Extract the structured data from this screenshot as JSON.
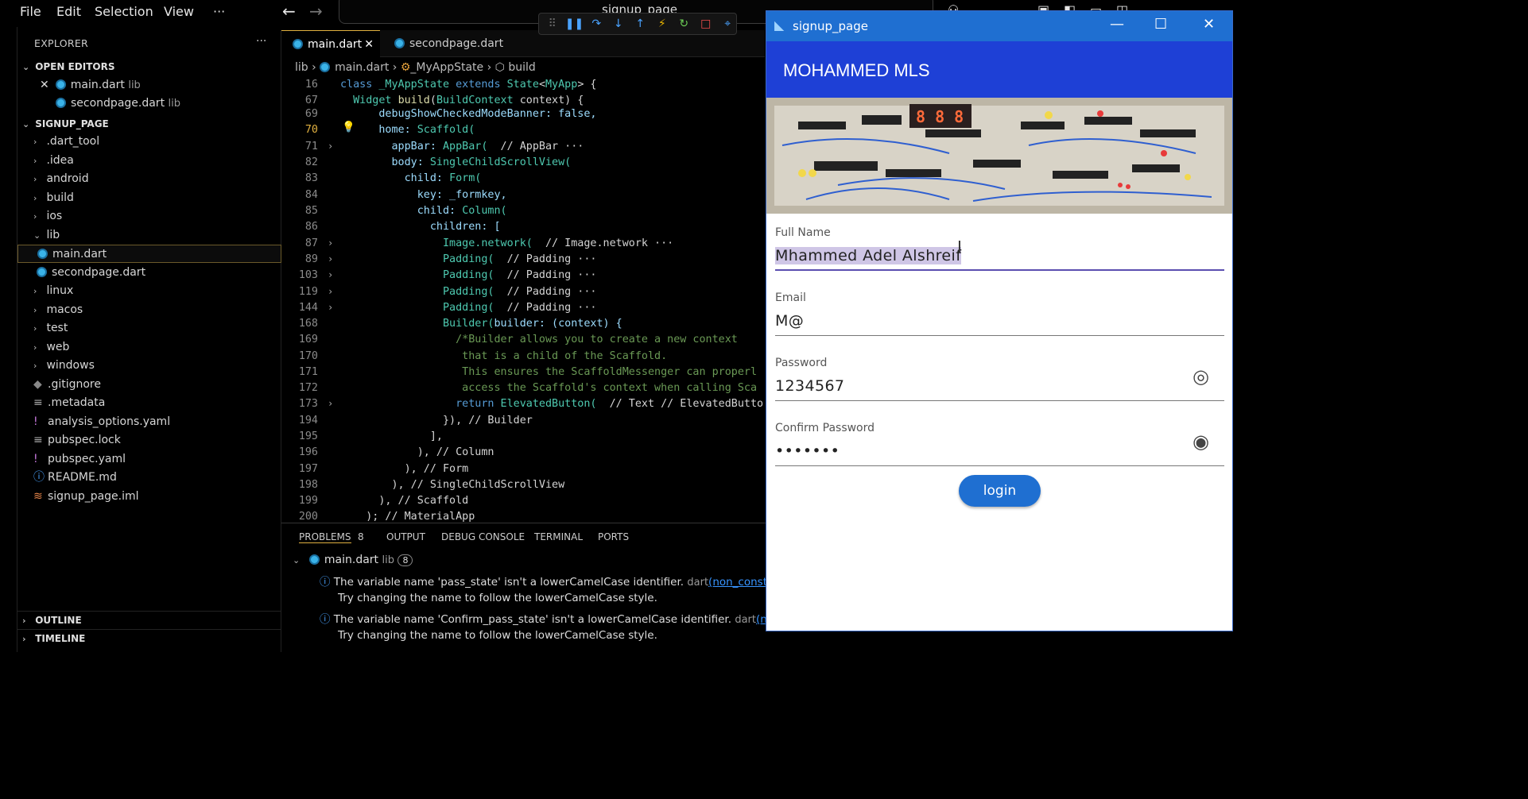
{
  "menubar": {
    "file": "File",
    "edit": "Edit",
    "selection": "Selection",
    "view": "View",
    "more": "···",
    "search": "signup_page"
  },
  "explorer": {
    "title": "EXPLORER",
    "open_editors": "OPEN EDITORS",
    "open": [
      {
        "name": "main.dart",
        "dir": "lib"
      },
      {
        "name": "secondpage.dart",
        "dir": "lib"
      }
    ],
    "project": "SIGNUP_PAGE",
    "items": [
      ".dart_tool",
      ".idea",
      "android",
      "build",
      "ios",
      "lib",
      "main.dart",
      "secondpage.dart",
      "linux",
      "macos",
      "test",
      "web",
      "windows",
      ".gitignore",
      ".metadata",
      "analysis_options.yaml",
      "pubspec.lock",
      "pubspec.yaml",
      "README.md",
      "signup_page.iml"
    ],
    "outline": "OUTLINE",
    "timeline": "TIMELINE"
  },
  "tabs": {
    "main": "main.dart",
    "second": "secondpage.dart"
  },
  "breadcrumb": {
    "lib": "lib",
    "file": "main.dart",
    "cls": "_MyAppState",
    "method": "build"
  },
  "code": {
    "lines": [
      "16",
      "67",
      "69",
      "70",
      "71",
      "82",
      "83",
      "84",
      "85",
      "86",
      "87",
      "89",
      "103",
      "119",
      "144",
      "168",
      "169",
      "170",
      "171",
      "172",
      "173",
      "194",
      "195",
      "196",
      "197",
      "198",
      "199",
      "200"
    ],
    "l16_a": "class ",
    "l16_b": "_MyAppState",
    "l16_c": " extends ",
    "l16_d": "State",
    "l16_e": "<",
    "l16_f": "MyApp",
    "l16_g": "> {",
    "l67_a": "  Widget ",
    "l67_b": "build",
    "l67_c": "(",
    "l67_d": "BuildContext",
    "l67_e": " context) {",
    "l69": "      debugShowCheckedModeBanner: false,",
    "l70_a": "      home: ",
    "l70_b": "Scaffold(",
    "l71_a": "        appBar: ",
    "l71_b": "AppBar(",
    "l71_c": "  // AppBar ···",
    "l82_a": "        body: ",
    "l82_b": "SingleChildScrollView(",
    "l83_a": "          child: ",
    "l83_b": "Form(",
    "l84": "            key: _formkey,",
    "l85_a": "            child: ",
    "l85_b": "Column(",
    "l86": "              children: [",
    "l87_a": "                ",
    "l87_b": "Image.network(",
    "l87_c": "  // Image.network ···",
    "l89_a": "                ",
    "l89_b": "Padding(",
    "l89_c": "  // Padding ···",
    "l103_c": "  // Padding ···",
    "l119_c": "  // Padding ···",
    "l144_c": "  // Padding ···",
    "l168_a": "                ",
    "l168_b": "Builder(",
    "l168_c": "builder: (context) {",
    "l169": "                  /*Builder allows you to create a new context",
    "l170": "                   that is a child of the Scaffold.",
    "l171": "                   This ensures the ScaffoldMessenger can properl",
    "l172": "                   access the Scaffold's context when calling Sca",
    "l173_a": "                  return ",
    "l173_b": "ElevatedButton(",
    "l173_c": "  // Text // ElevatedButto",
    "l194": "                }), // Builder",
    "l195": "              ],",
    "l196": "            ), // Column",
    "l197": "          ), // Form",
    "l198": "        ), // SingleChildScrollView",
    "l199": "      ), // Scaffold",
    "l200": "    ); // MaterialApp"
  },
  "panel": {
    "problems": "PROBLEMS",
    "count": "8",
    "output": "OUTPUT",
    "debug": "DEBUG CONSOLE",
    "terminal": "TERMINAL",
    "ports": "PORTS",
    "group_file": "main.dart",
    "group_dir": "lib",
    "group_count": "8",
    "p1": "The variable name 'pass_state' isn't a lowerCamelCase identifier.",
    "p1_src": "dart",
    "p1_link": "(non_constant_iden",
    "p1_hint": "Try changing the name to follow the lowerCamelCase style.",
    "p2": "The variable name 'Confirm_pass_state' isn't a lowerCamelCase identifier.",
    "p2_src": "dart",
    "p2_link": "(non_cons",
    "p2_hint": "Try changing the name to follow the lowerCamelCase style."
  },
  "app": {
    "window_title": "signup_page",
    "appbar_title": "MOHAMMED MLS",
    "fields": [
      {
        "label": "Full Name",
        "value": "Mhammed Adel Alshreif"
      },
      {
        "label": "Email",
        "value": "M@"
      },
      {
        "label": "Password",
        "value": "1234567"
      },
      {
        "label": "Confirm Password",
        "value": "•••••••"
      }
    ],
    "login": "login",
    "display_digits": "8 8 8"
  },
  "colors": {
    "brand_blue": "#1e40d6",
    "title_blue": "#1f6fd1",
    "focus": "#5b4fb0"
  }
}
